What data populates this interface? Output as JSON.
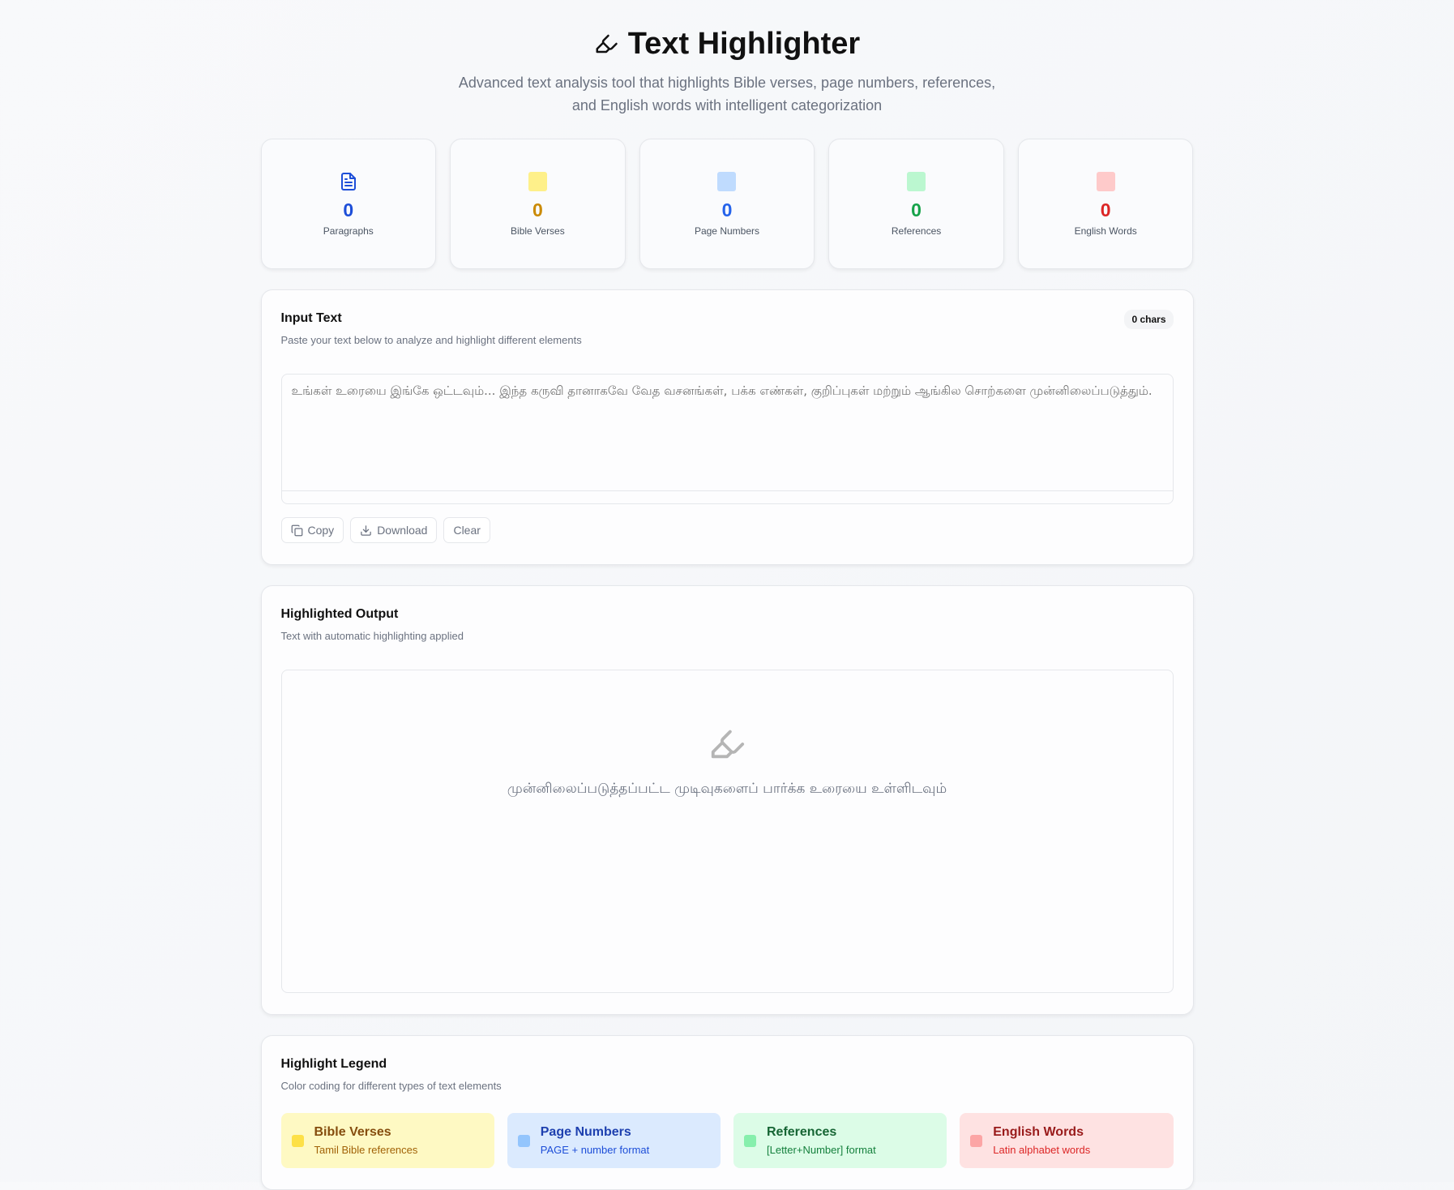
{
  "header": {
    "title": "Text Highlighter",
    "subtitle": "Advanced text analysis tool that highlights Bible verses, page numbers, references, and English words with intelligent categorization"
  },
  "stats": [
    {
      "value": "0",
      "label": "Paragraphs",
      "color": "#1d4ed8",
      "icon": "file-text-icon"
    },
    {
      "value": "0",
      "label": "Bible Verses",
      "color": "#ca8a04",
      "swatch": "#fef08a"
    },
    {
      "value": "0",
      "label": "Page Numbers",
      "color": "#2563eb",
      "swatch": "#bfdbfe"
    },
    {
      "value": "0",
      "label": "References",
      "color": "#16a34a",
      "swatch": "#bbf7d0"
    },
    {
      "value": "0",
      "label": "English Words",
      "color": "#dc2626",
      "swatch": "#fecaca"
    }
  ],
  "input": {
    "title": "Input Text",
    "subtitle": "Paste your text below to analyze and highlight different elements",
    "char_count": "0 chars",
    "value": "",
    "placeholder": "உங்கள் உரையை இங்கே ஒட்டவும்... இந்த கருவி தானாகவே வேத வசனங்கள், பக்க எண்கள், குறிப்புகள் மற்றும் ஆங்கில சொற்களை முன்னிலைப்படுத்தும்.",
    "copy": "Copy",
    "download": "Download",
    "clear": "Clear"
  },
  "output": {
    "title": "Highlighted Output",
    "subtitle": "Text with automatic highlighting applied",
    "empty": "முன்னிலைப்படுத்தப்பட்ட முடிவுகளைப் பார்க்க உரையை உள்ளிடவும்"
  },
  "legend": {
    "title": "Highlight Legend",
    "subtitle": "Color coding for different types of text elements",
    "items": [
      {
        "name": "Bible Verses",
        "desc": "Tamil Bible references"
      },
      {
        "name": "Page Numbers",
        "desc": "PAGE + number format"
      },
      {
        "name": "References",
        "desc": "[Letter+Number] format"
      },
      {
        "name": "English Words",
        "desc": "Latin alphabet words"
      }
    ]
  }
}
